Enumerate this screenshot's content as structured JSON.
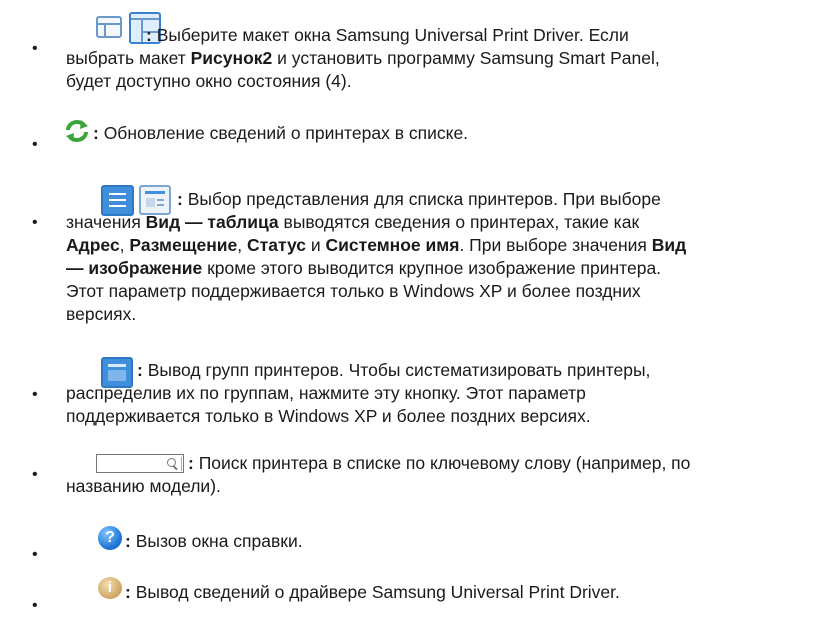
{
  "items": [
    {
      "id": "layout",
      "icon": "window-layout-icons",
      "lines": [
        [
          {
            "t": ":",
            "b": true
          },
          {
            "t": " Выберите макет окна Samsung Universal Print Driver. Если",
            "b": false
          }
        ],
        [
          {
            "t": "выбрать макет ",
            "b": false
          },
          {
            "t": "Рисунок2",
            "b": true
          },
          {
            "t": " и установить программу Samsung Smart Panel,",
            "b": false
          }
        ],
        [
          {
            "t": "будет доступно окно состояния (4).",
            "b": false
          }
        ]
      ]
    },
    {
      "id": "refresh",
      "icon": "refresh-icon",
      "lines": [
        [
          {
            "t": ":",
            "b": true
          },
          {
            "t": " Обновление сведений о принтерах в списке.",
            "b": false
          }
        ]
      ]
    },
    {
      "id": "view",
      "icon": "view-mode-icons",
      "lines": [
        [
          {
            "t": ":",
            "b": true
          },
          {
            "t": " Выбор представления для списка принтеров. При выборе",
            "b": false
          }
        ],
        [
          {
            "t": "значения ",
            "b": false
          },
          {
            "t": "Вид — таблица",
            "b": true
          },
          {
            "t": " выводятся сведения о принтерах, такие как",
            "b": false
          }
        ],
        [
          {
            "t": "Адрес",
            "b": true
          },
          {
            "t": ", ",
            "b": false
          },
          {
            "t": "Размещение",
            "b": true
          },
          {
            "t": ", ",
            "b": false
          },
          {
            "t": "Статус",
            "b": true
          },
          {
            "t": " и ",
            "b": false
          },
          {
            "t": "Системное имя",
            "b": true
          },
          {
            "t": ". При выборе значения ",
            "b": false
          },
          {
            "t": "Вид",
            "b": true
          }
        ],
        [
          {
            "t": "— изображение",
            "b": true
          },
          {
            "t": " кроме этого выводится крупное изображение принтера.",
            "b": false
          }
        ],
        [
          {
            "t": "Этот параметр поддерживается только в Windows XP и более поздних",
            "b": false
          }
        ],
        [
          {
            "t": "версиях.",
            "b": false
          }
        ]
      ]
    },
    {
      "id": "groups",
      "icon": "printer-groups-icon",
      "lines": [
        [
          {
            "t": ":",
            "b": true
          },
          {
            "t": " Вывод групп принтеров. Чтобы систематизировать принтеры,",
            "b": false
          }
        ],
        [
          {
            "t": "распределив их по группам, нажмите эту кнопку. Этот параметр",
            "b": false
          }
        ],
        [
          {
            "t": "поддерживается только в Windows XP и более поздних версиях.",
            "b": false
          }
        ]
      ]
    },
    {
      "id": "search",
      "icon": "search-field-icon",
      "lines": [
        [
          {
            "t": ":",
            "b": true
          },
          {
            "t": " Поиск принтера в списке по ключевому слову (например, по",
            "b": false
          }
        ],
        [
          {
            "t": "названию модели).",
            "b": false
          }
        ]
      ]
    },
    {
      "id": "help",
      "icon": "help-icon",
      "lines": [
        [
          {
            "t": ":",
            "b": true
          },
          {
            "t": " Вызов окна справки.",
            "b": false
          }
        ]
      ]
    },
    {
      "id": "about",
      "icon": "info-icon",
      "lines": [
        [
          {
            "t": ":",
            "b": true
          },
          {
            "t": " Вывод сведений о драйвере Samsung Universal Print Driver.",
            "b": false
          }
        ]
      ]
    }
  ],
  "bullet_char": "•",
  "glyphs": {
    "help": "?",
    "info": "i"
  },
  "colors": {
    "text": "#1a1a1a",
    "icon_blue": "#3f8fdc",
    "refresh_green": "#3aa63a"
  }
}
